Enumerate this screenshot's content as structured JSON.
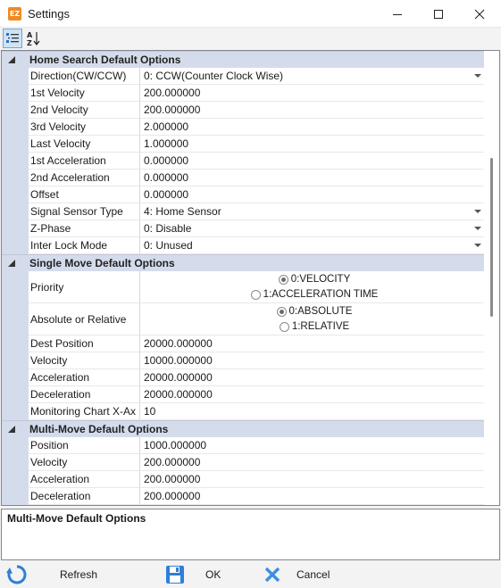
{
  "window": {
    "title": "Settings",
    "app_icon_text": "EZ"
  },
  "toolbar": {
    "categorized_icon": "categorized-icon",
    "alphabetical_icon": "sort-az-icon"
  },
  "sections": [
    {
      "title": "Home Search Default Options",
      "rows": [
        {
          "name": "Direction(CW/CCW)",
          "value": "0: CCW(Counter Clock Wise)",
          "dropdown": true
        },
        {
          "name": "1st Velocity",
          "value": "200.000000"
        },
        {
          "name": "2nd Velocity",
          "value": "200.000000"
        },
        {
          "name": "3rd Velocity",
          "value": "2.000000"
        },
        {
          "name": "Last Velocity",
          "value": "1.000000"
        },
        {
          "name": "1st Acceleration",
          "value": "0.000000"
        },
        {
          "name": "2nd Acceleration",
          "value": "0.000000"
        },
        {
          "name": "Offset",
          "value": "0.000000"
        },
        {
          "name": "Signal Sensor Type",
          "value": "4: Home Sensor",
          "dropdown": true
        },
        {
          "name": "Z-Phase",
          "value": "0: Disable",
          "dropdown": true
        },
        {
          "name": "Inter Lock Mode",
          "value": "0: Unused",
          "dropdown": true
        }
      ]
    },
    {
      "title": "Single Move Default Options",
      "rows": [
        {
          "name": "Priority",
          "radio": true,
          "options": [
            "0:VELOCITY",
            "1:ACCELERATION TIME"
          ],
          "selected": 0
        },
        {
          "name": "Absolute or Relative",
          "radio": true,
          "options": [
            "0:ABSOLUTE",
            "1:RELATIVE"
          ],
          "selected": 0
        },
        {
          "name": "Dest Position",
          "value": "20000.000000"
        },
        {
          "name": "Velocity",
          "value": "10000.000000"
        },
        {
          "name": "Acceleration",
          "value": "20000.000000"
        },
        {
          "name": "Deceleration",
          "value": "20000.000000"
        },
        {
          "name": "Monitoring Chart X-Ax",
          "value": "10"
        }
      ]
    },
    {
      "title": "Multi-Move Default Options",
      "rows": [
        {
          "name": "Position",
          "value": "1000.000000"
        },
        {
          "name": "Velocity",
          "value": "200.000000"
        },
        {
          "name": "Acceleration",
          "value": "200.000000"
        },
        {
          "name": "Deceleration",
          "value": "200.000000"
        }
      ]
    }
  ],
  "description": {
    "title": "Multi-Move Default Options"
  },
  "buttons": {
    "refresh": "Refresh",
    "ok": "OK",
    "cancel": "Cancel"
  },
  "colors": {
    "category_bg": "#d4dcec",
    "accent_blue": "#2f7fd6",
    "cancel_blue": "#3d8fe0"
  }
}
